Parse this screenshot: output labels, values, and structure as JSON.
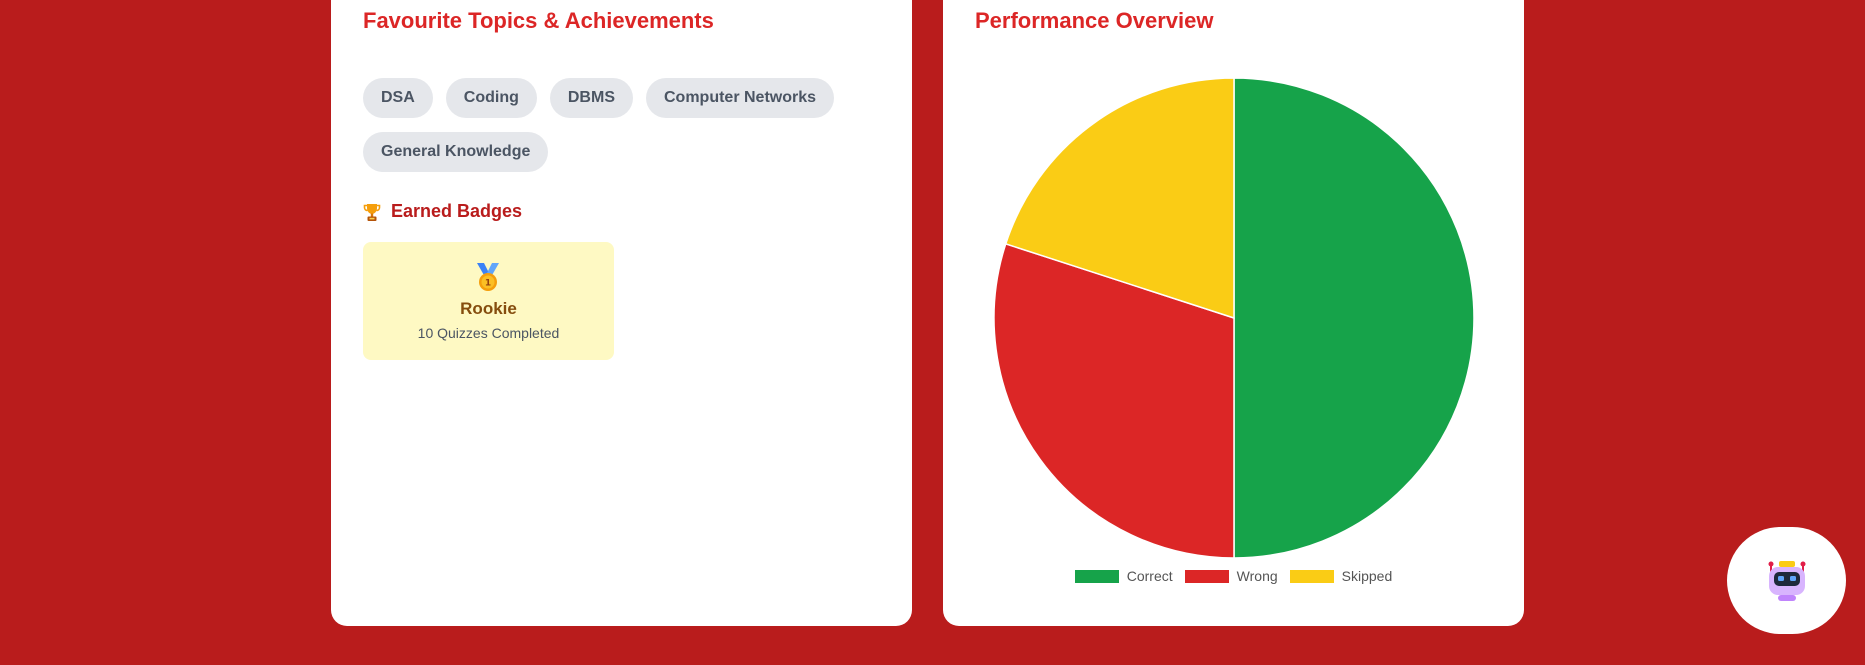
{
  "topics": {
    "title": "Favourite Topics & Achievements",
    "chips": [
      "DSA",
      "Coding",
      "DBMS",
      "Computer Networks",
      "General Knowledge"
    ]
  },
  "badges": {
    "heading": "Earned Badges",
    "heading_icon": "trophy-icon",
    "items": [
      {
        "icon": "medal-first-place-icon",
        "medal_number": "1",
        "name": "Rookie",
        "description": "10 Quizzes Completed"
      }
    ]
  },
  "performance": {
    "title": "Performance Overview"
  },
  "chart_data": {
    "type": "pie",
    "categories": [
      "Correct",
      "Wrong",
      "Skipped"
    ],
    "values": [
      50,
      30,
      20
    ],
    "colors": [
      "#16a34a",
      "#dc2626",
      "#facc15"
    ],
    "legend_position": "bottom"
  },
  "chatbot": {
    "icon": "robot-icon"
  }
}
